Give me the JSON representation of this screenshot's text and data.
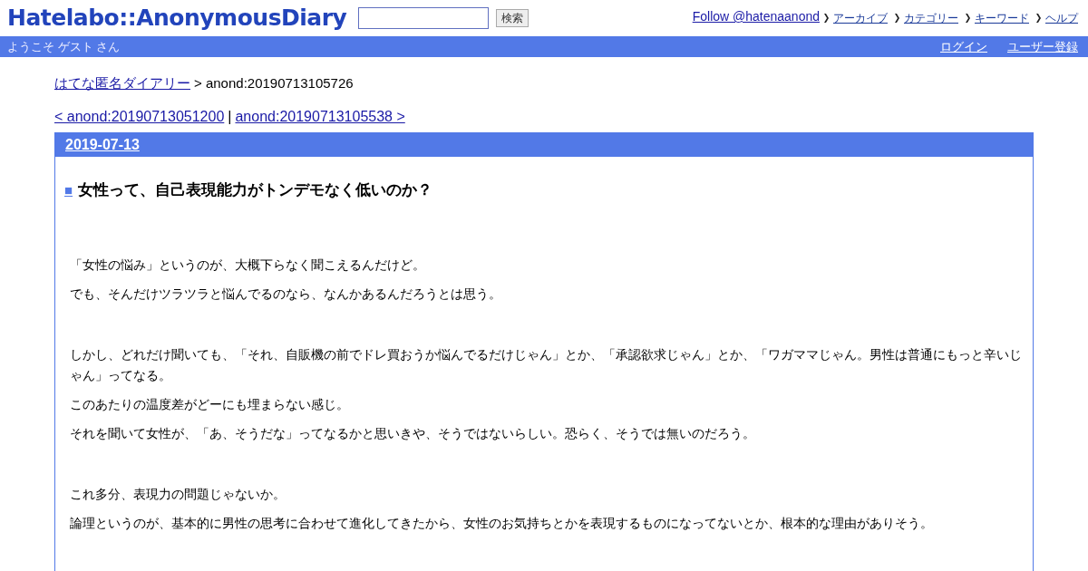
{
  "header": {
    "logo": "Hatelabo::AnonymousDiary",
    "search": {
      "button": "検索"
    },
    "follow_link": "Follow @hatenaanond",
    "nav_links": [
      "アーカイブ",
      "カテゴリー",
      "キーワード",
      "ヘルプ"
    ]
  },
  "user_bar": {
    "welcome": "ようこそ ゲスト さん",
    "links": [
      "ログイン",
      "ユーザー登録"
    ]
  },
  "breadcrumb": {
    "link": "はてな匿名ダイアリー",
    "current": "> anond:20190713105726"
  },
  "pager": {
    "prev": "< anond:20190713051200",
    "separator": "|",
    "next": "anond:20190713105538 >"
  },
  "day": {
    "date": "2019-07-13",
    "section_mark": "■",
    "title": "女性って、自己表現能力がトンデモなく低いのか？",
    "groups": [
      [
        "「女性の悩み」というのが、大概下らなく聞こえるんだけど。",
        "でも、そんだけツラツラと悩んでるのなら、なんかあるんだろうとは思う。"
      ],
      [
        "しかし、どれだけ聞いても、「それ、自販機の前でドレ買おうか悩んでるだけじゃん」とか、「承認欲求じゃん」とか、「ワガママじゃん。男性は普通にもっと辛いじゃん」ってなる。",
        "このあたりの温度差がどーにも埋まらない感じ。",
        "それを聞いて女性が、「あ、そうだな」ってなるかと思いきや、そうではないらしい。恐らく、そうでは無いのだろう。"
      ],
      [
        "これ多分、表現力の問題じゃないか。",
        "論理というのが、基本的に男性の思考に合わせて進化してきたから、女性のお気持ちとかを表現するものになってないとか、根本的な理由がありそう。"
      ]
    ]
  }
}
